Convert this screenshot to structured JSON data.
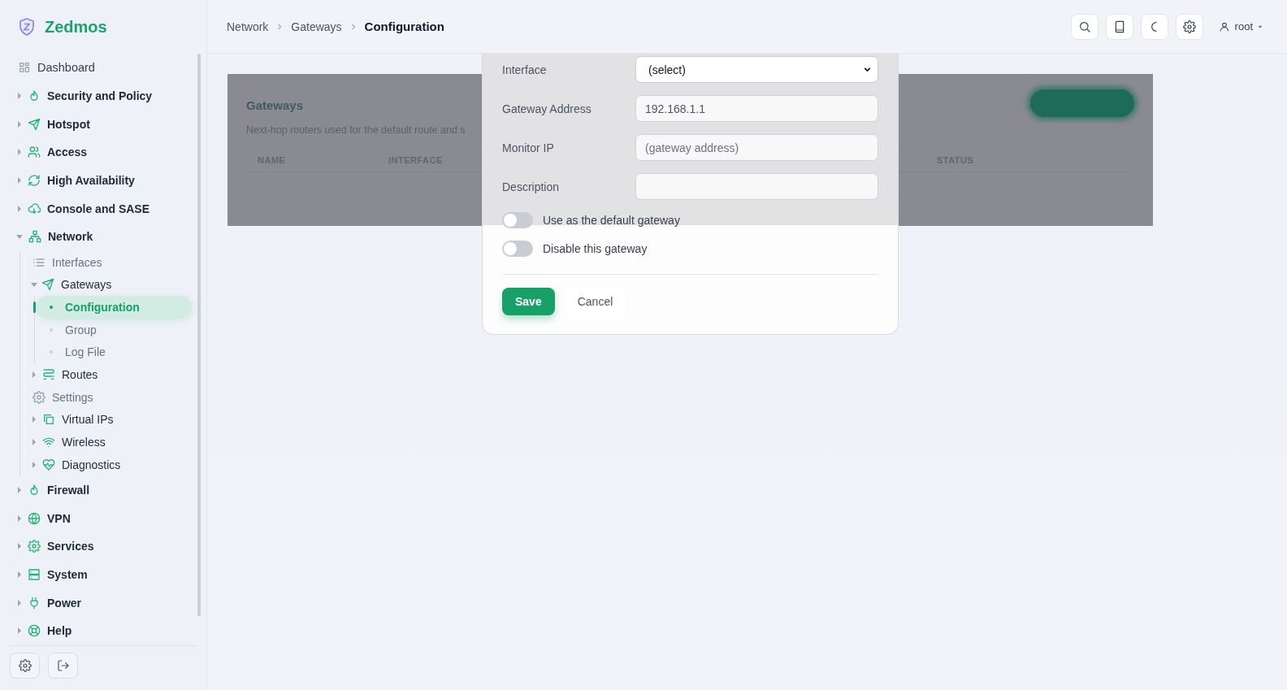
{
  "brand": {
    "name": "Zedmos"
  },
  "sidebar": {
    "items": [
      {
        "label": "Dashboard",
        "kind": "link"
      },
      {
        "label": "Security and Policy",
        "kind": "group",
        "expanded": false
      },
      {
        "label": "Hotspot",
        "kind": "group",
        "expanded": false
      },
      {
        "label": "Access",
        "kind": "group",
        "expanded": false
      },
      {
        "label": "High Availability",
        "kind": "group",
        "expanded": false
      },
      {
        "label": "Console and SASE",
        "kind": "group",
        "expanded": false
      },
      {
        "label": "Network",
        "kind": "group",
        "expanded": true,
        "children": [
          {
            "label": "Interfaces",
            "kind": "link"
          },
          {
            "label": "Gateways",
            "kind": "group",
            "expanded": true,
            "children": [
              {
                "label": "Configuration",
                "kind": "leaf",
                "selected": true
              },
              {
                "label": "Group",
                "kind": "leaf",
                "selected": false
              },
              {
                "label": "Log File",
                "kind": "leaf",
                "selected": false
              }
            ]
          },
          {
            "label": "Routes",
            "kind": "group",
            "expanded": false
          },
          {
            "label": "Settings",
            "kind": "link"
          },
          {
            "label": "Virtual IPs",
            "kind": "group",
            "expanded": false
          },
          {
            "label": "Wireless",
            "kind": "group",
            "expanded": false
          },
          {
            "label": "Diagnostics",
            "kind": "group",
            "expanded": false
          }
        ]
      },
      {
        "label": "Firewall",
        "kind": "group",
        "expanded": false
      },
      {
        "label": "VPN",
        "kind": "group",
        "expanded": false
      },
      {
        "label": "Services",
        "kind": "group",
        "expanded": false
      },
      {
        "label": "System",
        "kind": "group",
        "expanded": false
      },
      {
        "label": "Power",
        "kind": "group",
        "expanded": false
      },
      {
        "label": "Help",
        "kind": "group",
        "expanded": false
      }
    ]
  },
  "header": {
    "breadcrumbs": [
      "Network",
      "Gateways",
      "Configuration"
    ],
    "user": "root"
  },
  "card": {
    "title": "Gateways",
    "description": "Next-hop routers used for the default route and s",
    "columns": [
      "NAME",
      "INTERFACE",
      "STATUS"
    ]
  },
  "modal": {
    "fields": [
      {
        "label": "Interface",
        "kind": "select",
        "value": "(select)"
      },
      {
        "label": "Gateway Address",
        "kind": "text",
        "value": "192.168.1.1"
      },
      {
        "label": "Monitor IP",
        "kind": "text",
        "placeholder": "(gateway address)"
      },
      {
        "label": "Description",
        "kind": "text"
      }
    ],
    "toggles": [
      {
        "label": "Use as the default gateway",
        "on": false
      },
      {
        "label": "Disable this gateway",
        "on": false
      }
    ],
    "buttons": [
      {
        "label": "Save",
        "kind": "primary"
      },
      {
        "label": "Cancel",
        "kind": "secondary"
      }
    ]
  }
}
